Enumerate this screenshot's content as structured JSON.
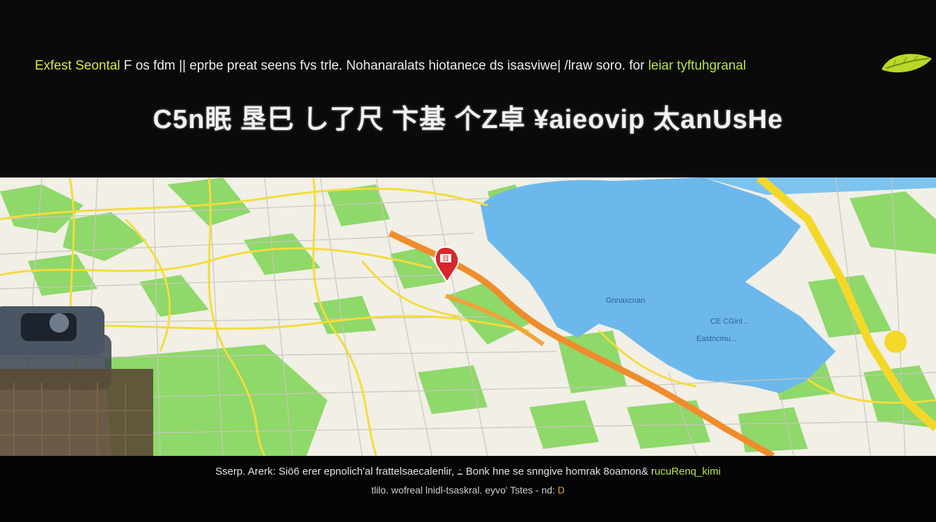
{
  "header": {
    "prefix": "Exfest Seontal",
    "middle": " F os fdm || eprbe preat seens fvs trle. Nohanaralats hiotanece ds isasviwe| /lraw soro. for",
    "suffix": " leiar tyftuhgranal"
  },
  "headline": "C5n眠 垦巳 し了尺 卞基 个Z卓 ¥aieovip 太anUsHe",
  "map": {
    "water_color": "#6cb8ec",
    "park_color": "#8fd86a",
    "land_color": "#f1efe6",
    "road_color": "#f3dc3c",
    "highway_color": "#f08c2a",
    "marker_label": "目",
    "water_labels": [
      "Gnnaxcnan",
      "CE CGinl ..",
      "Eastncmu..."
    ]
  },
  "captions": {
    "line1_main": "Sserp. Arerk: Siö6 erer epnolich'al frattelsaecalenlir, ߸ Bonk hne se snngive homrak 8oamon& r",
    "line1_accent": "ucuRenq_kimi",
    "line2_main": "tlilo. wofreal lnidl-tsaskral. eyvo' Tstes - nd:",
    "line2_accent": " D"
  },
  "icons": {
    "leaf": "leaf-icon",
    "marker": "map-marker-icon",
    "device": "gps-device-icon"
  }
}
